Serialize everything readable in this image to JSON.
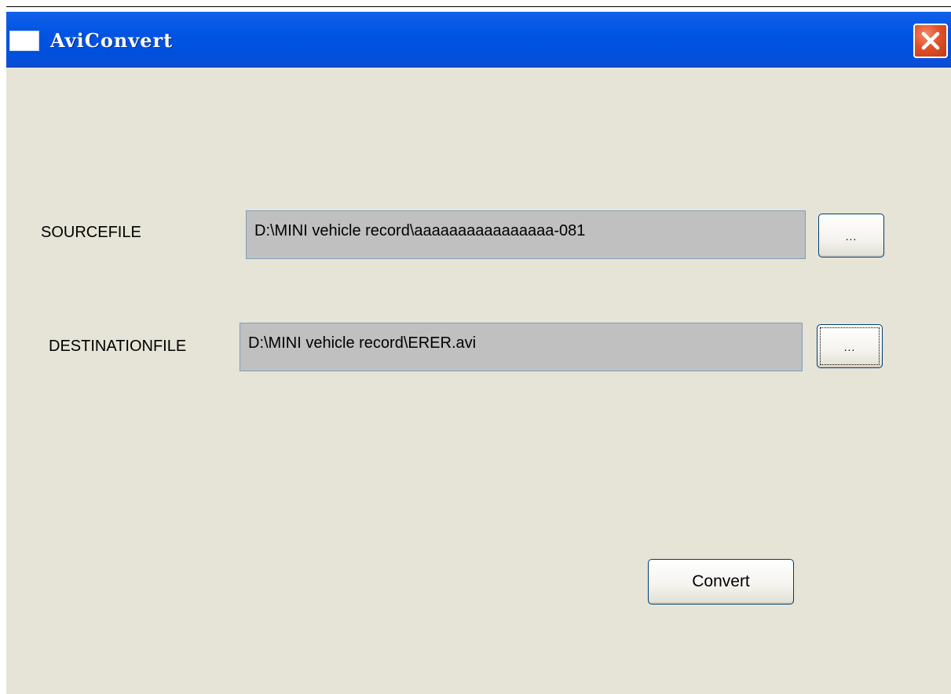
{
  "window": {
    "title": "AviConvert"
  },
  "form": {
    "source": {
      "label": "SOURCEFILE",
      "value": "D:\\MINI vehicle record\\aaaaaaaaaaaaaaaa-081",
      "browse_label": "..."
    },
    "destination": {
      "label": "DESTINATIONFILE",
      "value": "D:\\MINI vehicle record\\ERER.avi",
      "browse_label": "..."
    },
    "convert_label": "Convert"
  },
  "icons": {
    "app": "window-icon",
    "close": "close-icon"
  },
  "colors": {
    "titlebar": "#0054e3",
    "window_background": "#e5e4d6",
    "field_background": "#c0c0c0",
    "close_button": "#e2512a"
  }
}
